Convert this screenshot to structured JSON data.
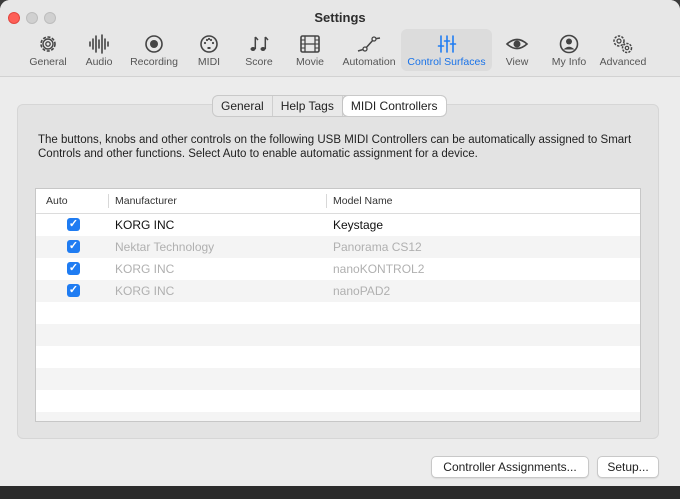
{
  "window": {
    "title": "Settings"
  },
  "toolbar": {
    "items": [
      {
        "label": "General",
        "icon": "gear-icon"
      },
      {
        "label": "Audio",
        "icon": "waveform-icon"
      },
      {
        "label": "Recording",
        "icon": "record-icon"
      },
      {
        "label": "MIDI",
        "icon": "midi-port-icon"
      },
      {
        "label": "Score",
        "icon": "music-notes-icon"
      },
      {
        "label": "Movie",
        "icon": "film-icon"
      },
      {
        "label": "Automation",
        "icon": "automation-curve-icon"
      },
      {
        "label": "Control Surfaces",
        "icon": "sliders-icon",
        "active": true
      },
      {
        "label": "View",
        "icon": "eye-icon"
      },
      {
        "label": "My Info",
        "icon": "person-icon"
      },
      {
        "label": "Advanced",
        "icon": "gears-icon"
      }
    ]
  },
  "tabs": [
    "General",
    "Help Tags",
    "MIDI Controllers"
  ],
  "selected_tab": "MIDI Controllers",
  "description": "The buttons, knobs and other controls on the following USB MIDI Controllers can be automatically assigned to Smart Controls and other functions. Select Auto to enable automatic assignment for a device.",
  "table": {
    "columns": [
      "Auto",
      "Manufacturer",
      "Model Name"
    ],
    "rows": [
      {
        "auto": true,
        "manufacturer": "KORG INC",
        "model": "Keystage",
        "dim": false
      },
      {
        "auto": true,
        "manufacturer": "Nektar Technology",
        "model": "Panorama CS12",
        "dim": true
      },
      {
        "auto": true,
        "manufacturer": "KORG INC",
        "model": "nanoKONTROL2",
        "dim": true
      },
      {
        "auto": true,
        "manufacturer": "KORG INC",
        "model": "nanoPAD2",
        "dim": true
      }
    ]
  },
  "buttons": {
    "assignments": "Controller Assignments...",
    "setup": "Setup..."
  },
  "colors": {
    "accent": "#1f7cf2",
    "close": "#fe5f57"
  }
}
